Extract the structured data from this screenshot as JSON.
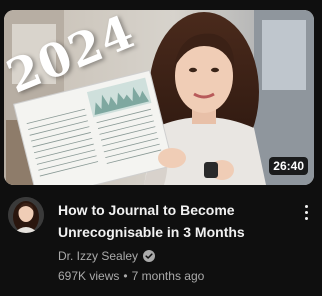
{
  "video": {
    "overlay_text": "2024",
    "duration": "26:40",
    "title": "How to Journal to Become Unrecognisable in 3 Months",
    "channel": "Dr. Izzy Sealey",
    "views": "697K views",
    "separator": "•",
    "age": "7 months ago"
  },
  "icons": {
    "verified": "verified-check-icon",
    "menu": "more-vert-icon"
  },
  "colors": {
    "background": "#0f0f0f",
    "title": "#f1f1f1",
    "meta": "#aaaaaa"
  }
}
